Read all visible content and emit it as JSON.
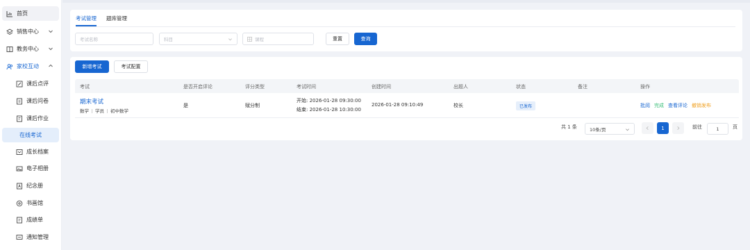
{
  "sidebar": {
    "items": [
      {
        "label": "首页",
        "icon": "chart-icon"
      },
      {
        "label": "销售中心",
        "icon": "layers-icon"
      },
      {
        "label": "教务中心",
        "icon": "book-icon"
      },
      {
        "label": "家校互动",
        "icon": "users-icon"
      },
      {
        "label": "课后点评",
        "icon": "edit-icon"
      },
      {
        "label": "课后问卷",
        "icon": "document-icon"
      },
      {
        "label": "课后作业",
        "icon": "homework-icon"
      },
      {
        "label": "在线考试",
        "icon": ""
      },
      {
        "label": "成长档案",
        "icon": "folder-icon"
      },
      {
        "label": "电子相册",
        "icon": "image-icon"
      },
      {
        "label": "纪念册",
        "icon": "album-icon"
      },
      {
        "label": "书画馆",
        "icon": "palette-icon"
      },
      {
        "label": "成绩单",
        "icon": "report-icon"
      },
      {
        "label": "通知管理",
        "icon": "message-icon"
      }
    ]
  },
  "tabs": [
    "考试管理",
    "题库管理"
  ],
  "filters": {
    "exam_name_placeholder": "考试名称",
    "subject_placeholder": "科目",
    "course_placeholder": "课程",
    "reset_label": "重置",
    "query_label": "查询"
  },
  "actions": {
    "add_exam": "新增考试",
    "exam_config": "考试配置"
  },
  "table": {
    "headers": [
      "考试",
      "是否开启评论",
      "评分类型",
      "考试时间",
      "创建时间",
      "出题人",
      "状态",
      "备注",
      "操作"
    ],
    "rows": [
      {
        "name": "期末考试",
        "tags": [
          "数学",
          "学员",
          "初中数学"
        ],
        "comment_enabled": "是",
        "score_type": "赋分制",
        "start": "开始: 2026-01-28 09:30:00",
        "end": "结束: 2026-01-28 10:30:00",
        "created": "2026-01-28 09:10:49",
        "author": "校长",
        "status": "已发布",
        "note": "",
        "ops": [
          "批阅",
          "完成",
          "查看评论",
          "撤销发布"
        ]
      }
    ]
  },
  "pagination": {
    "total": "共 1 条",
    "page_size": "10条/页",
    "current_page": "1",
    "goto_label": "前往",
    "goto_value": "1",
    "page_suffix": "页"
  },
  "colors": {
    "primary": "#1766d1",
    "op_review": "#1766d1",
    "op_done": "#3cbf7a",
    "op_comments": "#1766d1",
    "op_revoke": "#f0a020"
  }
}
